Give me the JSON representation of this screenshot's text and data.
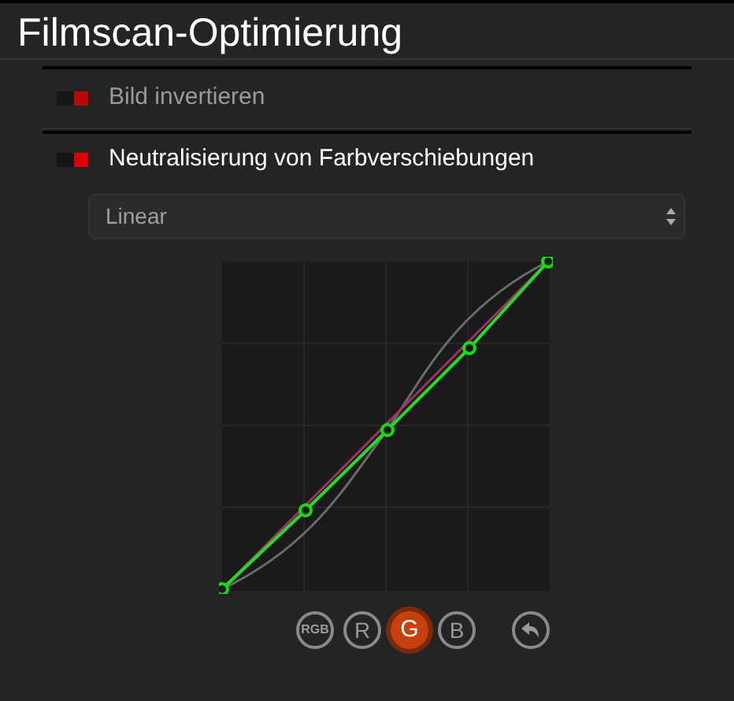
{
  "title": "Filmscan-Optimierung",
  "options": [
    {
      "label": "Bild invertieren",
      "on": true,
      "disabled": true
    },
    {
      "label": "Neutralisierung von Farbverschiebungen",
      "on": true,
      "disabled": false
    }
  ],
  "curve_mode": {
    "value": "Linear"
  },
  "channels": [
    {
      "label": "RGB",
      "selected": false
    },
    {
      "label": "R",
      "selected": false
    },
    {
      "label": "G",
      "selected": true
    },
    {
      "label": "B",
      "selected": false
    }
  ]
}
